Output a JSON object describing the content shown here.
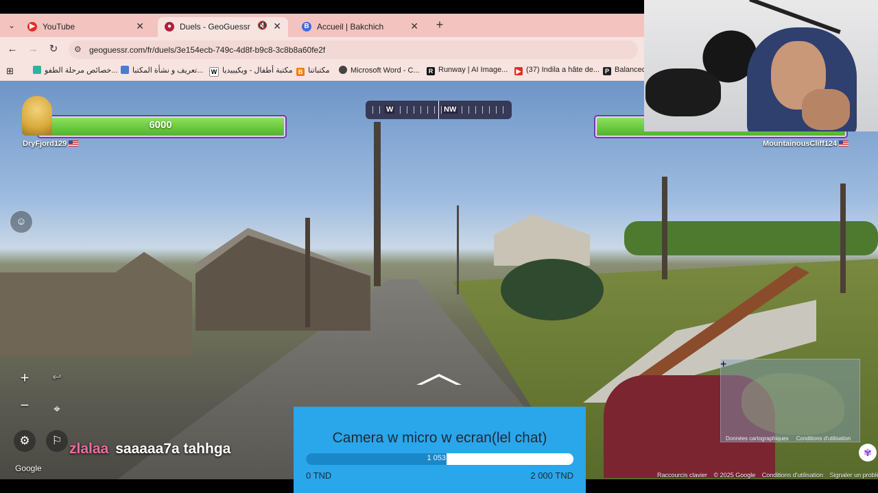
{
  "browser": {
    "tabs": [
      {
        "label": "YouTube",
        "icon": "youtube-icon",
        "active": false
      },
      {
        "label": "Duels - GeoGuessr",
        "icon": "geoguessr-pin-icon",
        "active": true,
        "muted": true
      },
      {
        "label": "Accueil | Bakchich",
        "icon": "bakchich-b-icon",
        "active": false
      }
    ],
    "url": "geoguessr.com/fr/duels/3e154ecb-749c-4d8f-b9c8-3c8b8a60fe2f",
    "bookmarks": [
      {
        "label": "خصائص مرحلة الطفو...",
        "icon": "apps-icon"
      },
      {
        "label": "تعريف و نشأة المكتبا...",
        "icon": "doc-icon"
      },
      {
        "label": "مكتبة أطفال - ويكيبيديا",
        "icon": "wikipedia-icon"
      },
      {
        "label": "مكتباتنا",
        "icon": "blogger-icon"
      },
      {
        "label": "Microsoft Word - C...",
        "icon": "globe-icon"
      },
      {
        "label": "Runway | AI Image...",
        "icon": "runway-icon"
      },
      {
        "label": "(37) Indila a hâte de...",
        "icon": "youtube-icon"
      },
      {
        "label": "Balanced",
        "icon": "p-icon"
      }
    ]
  },
  "game": {
    "player_left": {
      "name": "DryFjord129",
      "health": "6000",
      "health_fraction": 1.0
    },
    "player_right": {
      "name": "MountainousCliff124",
      "health_fraction": 1.0
    },
    "compass": {
      "west": "W",
      "northwest": "NW"
    },
    "chat": {
      "user": "zlalaa",
      "message": "saaaaa7a tahhga"
    },
    "google_mark": "Google",
    "footer_links": [
      "Raccourcis clavier",
      "© 2025 Google",
      "Conditions d'utilisation",
      "Signaler un problème"
    ],
    "minimap_footer": [
      "Données cartographiques",
      "Conditions d'utilisation"
    ]
  },
  "donation_goal": {
    "title": "Camera w micro w ecran(lel chat)",
    "current": "1 053",
    "min_label": "0 TND",
    "max_label": "2 000 TND",
    "current_value": 1053,
    "max_value": 2000
  },
  "colors": {
    "tab_strip": "#f2c3bf",
    "health_green": "#4fb52e",
    "goal_blue": "#2aa6ea",
    "chat_user_pink": "#f06aa0"
  }
}
